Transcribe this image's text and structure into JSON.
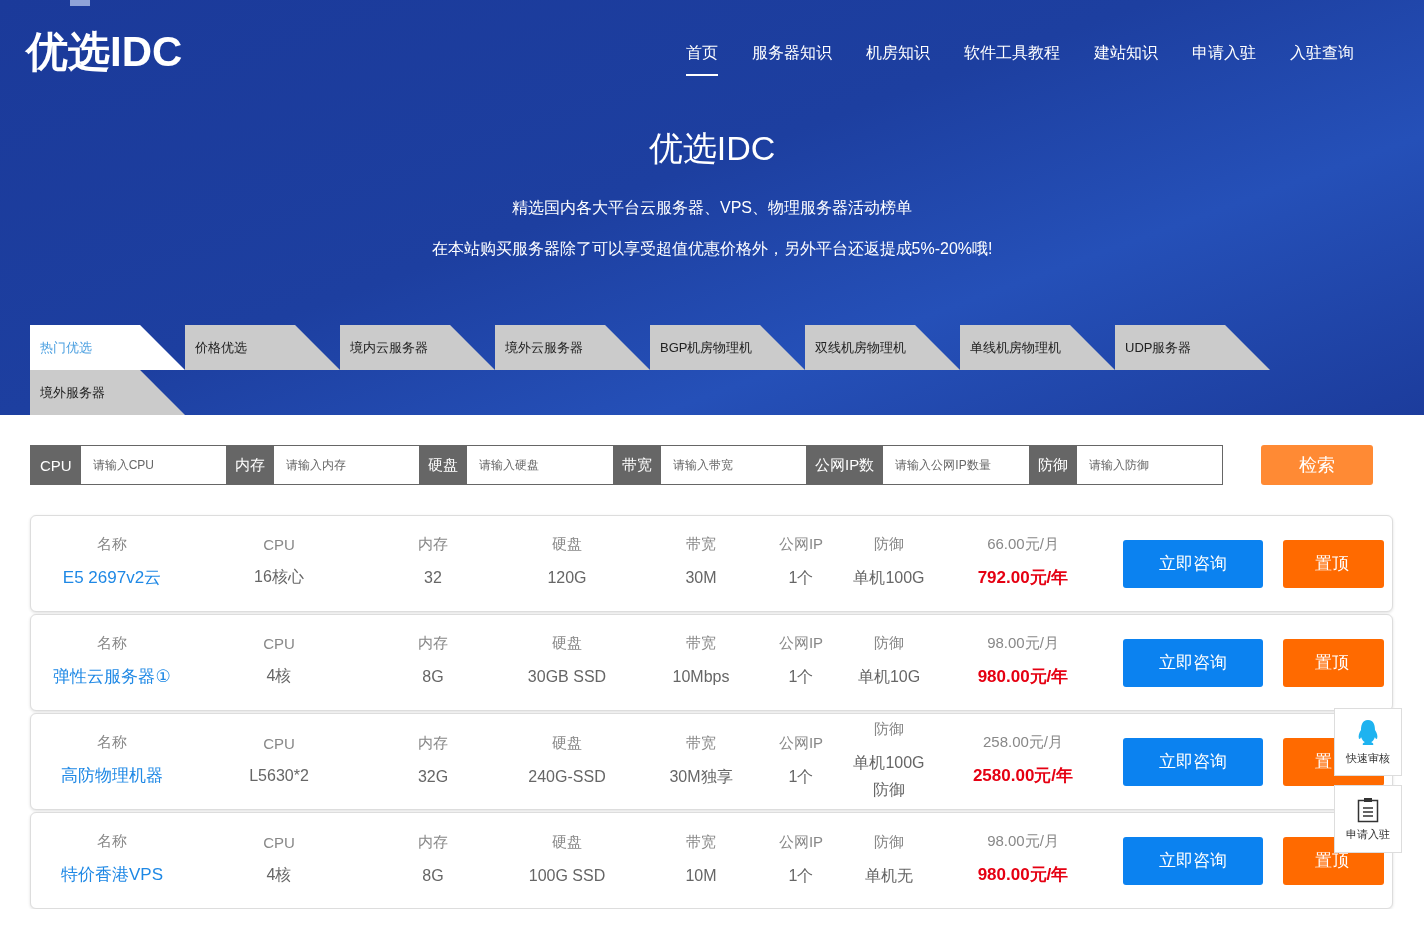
{
  "logo": "优选IDC",
  "nav": [
    {
      "label": "首页",
      "selected": true
    },
    {
      "label": "服务器知识",
      "selected": false
    },
    {
      "label": "机房知识",
      "selected": false
    },
    {
      "label": "软件工具教程",
      "selected": false
    },
    {
      "label": "建站知识",
      "selected": false
    },
    {
      "label": "申请入驻",
      "selected": false
    },
    {
      "label": "入驻查询",
      "selected": false
    }
  ],
  "hero": {
    "title": "优选IDC",
    "lines": [
      "精选国内各大平台云服务器、VPS、物理服务器活动榜单",
      "在本站购买服务器除了可以享受超值优惠价格外，另外平台还返提成5%-20%哦!"
    ]
  },
  "tabs": [
    {
      "label": "热门优选",
      "selected": true
    },
    {
      "label": "价格优选",
      "selected": false
    },
    {
      "label": "境内云服务器",
      "selected": false
    },
    {
      "label": "境外云服务器",
      "selected": false
    },
    {
      "label": "BGP机房物理机",
      "selected": false
    },
    {
      "label": "双线机房物理机",
      "selected": false
    },
    {
      "label": "单线机房物理机",
      "selected": false
    },
    {
      "label": "UDP服务器",
      "selected": false
    },
    {
      "label": "境外服务器",
      "selected": false
    }
  ],
  "filters": [
    {
      "label": "CPU",
      "placeholder": "请输入CPU"
    },
    {
      "label": "内存",
      "placeholder": "请输入内存"
    },
    {
      "label": "硬盘",
      "placeholder": "请输入硬盘"
    },
    {
      "label": "带宽",
      "placeholder": "请输入带宽"
    },
    {
      "label": "公网IP数",
      "placeholder": "请输入公网IP数量"
    },
    {
      "label": "防御",
      "placeholder": "请输入防御"
    }
  ],
  "search_button": "检索",
  "products": [
    {
      "cells": [
        {
          "kind": "name",
          "label": "名称",
          "value": "E5 2697v2云"
        },
        {
          "kind": "spec",
          "label": "CPU",
          "value": "16核心"
        },
        {
          "kind": "spec",
          "label": "内存",
          "value": "32"
        },
        {
          "kind": "spec",
          "label": "硬盘",
          "value": "120G"
        },
        {
          "kind": "spec",
          "label": "带宽",
          "value": "30M"
        },
        {
          "kind": "spec",
          "label": "公网IP",
          "value": "1个"
        },
        {
          "kind": "spec",
          "label": "防御",
          "value": "单机100G"
        },
        {
          "kind": "price",
          "label": "66.00元/月",
          "value": "792.00元/年"
        }
      ],
      "buttons": [
        "立即咨询",
        "置顶"
      ]
    },
    {
      "cells": [
        {
          "kind": "name",
          "label": "名称",
          "value": "弹性云服务器①"
        },
        {
          "kind": "spec",
          "label": "CPU",
          "value": "4核"
        },
        {
          "kind": "spec",
          "label": "内存",
          "value": "8G"
        },
        {
          "kind": "spec",
          "label": "硬盘",
          "value": "30GB SSD"
        },
        {
          "kind": "spec",
          "label": "带宽",
          "value": "10Mbps"
        },
        {
          "kind": "spec",
          "label": "公网IP",
          "value": "1个"
        },
        {
          "kind": "spec",
          "label": "防御",
          "value": "单机10G"
        },
        {
          "kind": "price",
          "label": "98.00元/月",
          "value": "980.00元/年"
        }
      ],
      "buttons": [
        "立即咨询",
        "置顶"
      ]
    },
    {
      "cells": [
        {
          "kind": "name",
          "label": "名称",
          "value": "高防物理机器"
        },
        {
          "kind": "spec",
          "label": "CPU",
          "value": "L5630*2"
        },
        {
          "kind": "spec",
          "label": "内存",
          "value": "32G"
        },
        {
          "kind": "spec",
          "label": "硬盘",
          "value": "240G-SSD"
        },
        {
          "kind": "spec",
          "label": "带宽",
          "value": "30M独享"
        },
        {
          "kind": "spec",
          "label": "公网IP",
          "value": "1个"
        },
        {
          "kind": "spec",
          "label": "防御",
          "value": "单机100G防御"
        },
        {
          "kind": "price",
          "label": "258.00元/月",
          "value": "2580.00元/年"
        }
      ],
      "buttons": [
        "立即咨询",
        "置"
      ]
    },
    {
      "cells": [
        {
          "kind": "name",
          "label": "名称",
          "value": "特价香港VPS"
        },
        {
          "kind": "spec",
          "label": "CPU",
          "value": "4核"
        },
        {
          "kind": "spec",
          "label": "内存",
          "value": "8G"
        },
        {
          "kind": "spec",
          "label": "硬盘",
          "value": "100G SSD"
        },
        {
          "kind": "spec",
          "label": "带宽",
          "value": "10M"
        },
        {
          "kind": "spec",
          "label": "公网IP",
          "value": "1个"
        },
        {
          "kind": "spec",
          "label": "防御",
          "value": "单机无"
        },
        {
          "kind": "price",
          "label": "98.00元/月",
          "value": "980.00元/年"
        }
      ],
      "buttons": [
        "立即咨询",
        "置顶"
      ]
    }
  ],
  "side_widgets": [
    {
      "kind": "qq",
      "label": "快速审核"
    },
    {
      "kind": "clipboard",
      "label": "申请入驻"
    }
  ]
}
